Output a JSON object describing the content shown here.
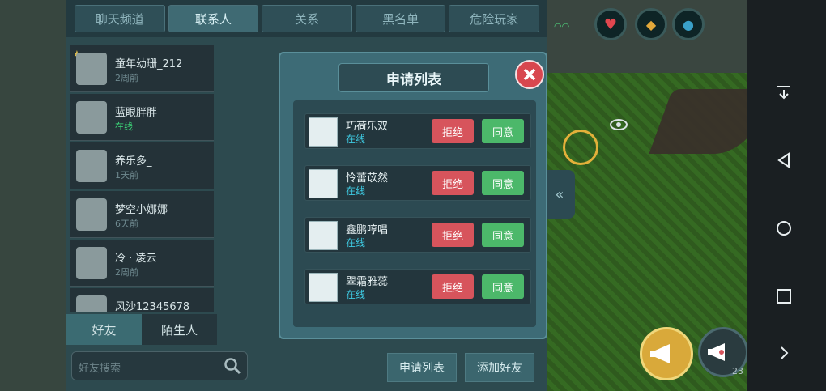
{
  "tabs": [
    "聊天频道",
    "联系人",
    "关系",
    "黑名单",
    "危险玩家"
  ],
  "active_tab": 1,
  "contacts": [
    {
      "name": "童年幼珊_212",
      "status": "2周前",
      "online": false,
      "star": true
    },
    {
      "name": "蓝眼胖胖",
      "status": "在线",
      "online": true,
      "star": false
    },
    {
      "name": "养乐多_",
      "status": "1天前",
      "online": false,
      "star": false
    },
    {
      "name": "梦空小娜娜",
      "status": "6天前",
      "online": false,
      "star": false
    },
    {
      "name": "冷 · 凌云",
      "status": "2周前",
      "online": false,
      "star": false
    },
    {
      "name": "风沙12345678",
      "status": "",
      "online": false,
      "star": false
    }
  ],
  "bottom_tabs": [
    "好友",
    "陌生人"
  ],
  "search": {
    "placeholder": "好友搜索"
  },
  "buttons": {
    "request_list": "申请列表",
    "add_friend": "添加好友"
  },
  "modal": {
    "title": "申请列表",
    "requests": [
      {
        "name": "巧荷乐双",
        "status": "在线"
      },
      {
        "name": "怜蕾苡然",
        "status": "在线"
      },
      {
        "name": "鑫鹏哼唱",
        "status": "在线"
      },
      {
        "name": "翠霜雅蕊",
        "status": "在线"
      }
    ],
    "reject": "拒绝",
    "accept": "同意"
  },
  "hud": {
    "count": "23"
  },
  "colors": {
    "accent": "#3ddc7b",
    "reject": "#d7545c",
    "accept": "#4cb86a"
  }
}
